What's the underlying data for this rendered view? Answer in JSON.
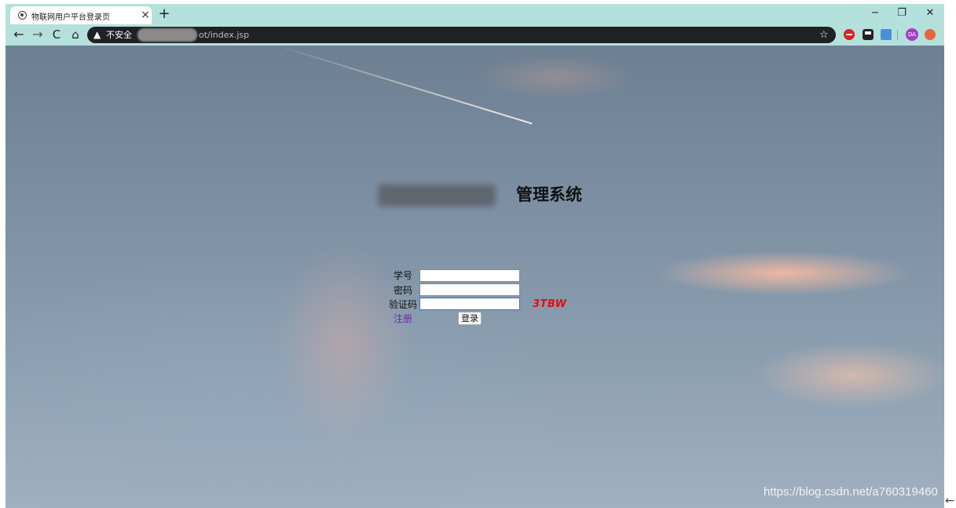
{
  "browser": {
    "tab_title": "物联网用户平台登录页",
    "tab_close": "×",
    "new_tab": "+",
    "window_controls": {
      "minimize": "−",
      "maximize": "❐",
      "close": "✕"
    },
    "nav": {
      "back": "←",
      "forward": "→",
      "reload": "C",
      "home": "⌂"
    },
    "security_label": "不安全",
    "url_visible": "ot/index.jsp",
    "icons": [
      "globe-icon",
      "warning-icon",
      "star-icon",
      "adblock-icon",
      "extension-icon",
      "translate-icon",
      "profile-avatar",
      "extension-icon"
    ],
    "avatar_initials": "DA"
  },
  "page": {
    "title": "管理系统",
    "form": {
      "student_id_label": "学号",
      "password_label": "密码",
      "captcha_label": "验证码",
      "student_id_value": "",
      "password_value": "",
      "captcha_value": "",
      "captcha_code": "3TBW",
      "register_link": "注册",
      "login_button": "登录"
    },
    "watermark": "https://blog.csdn.net/a760319460",
    "side_arrow": "←"
  },
  "colors": {
    "browser_frame": "#b4e1dc",
    "omnibox": "#202124",
    "captcha_code": "#e01010",
    "register_link": "#6a2a9a"
  }
}
